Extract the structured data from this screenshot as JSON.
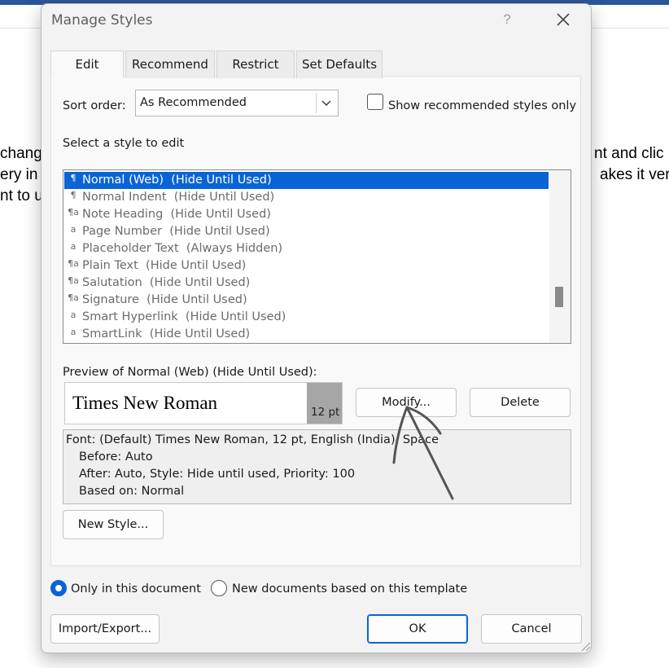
{
  "background": {
    "text_lines_left": [
      "chang",
      "ery in",
      "nt to u"
    ],
    "text_lines_right": [
      "nt and clic",
      "akes it ver"
    ]
  },
  "dialog": {
    "title": "Manage Styles",
    "help_label": "?",
    "close_icon": "close-icon",
    "tabs": [
      {
        "label": "Edit",
        "active": true
      },
      {
        "label": "Recommend",
        "active": false
      },
      {
        "label": "Restrict",
        "active": false
      },
      {
        "label": "Set Defaults",
        "active": false
      }
    ],
    "sort_order": {
      "label": "Sort order:",
      "value": "As Recommended"
    },
    "show_recommended": {
      "label": "Show recommended styles only",
      "checked": false
    },
    "select_label": "Select a style to edit",
    "styles": [
      {
        "icon": "¶",
        "name": "Normal (Web)",
        "note": "(Hide Until Used)",
        "selected": true
      },
      {
        "icon": "¶",
        "name": "Normal Indent",
        "note": "(Hide Until Used)",
        "selected": false
      },
      {
        "icon": "¶a",
        "name": "Note Heading",
        "note": "(Hide Until Used)",
        "selected": false
      },
      {
        "icon": "a",
        "name": "Page Number",
        "note": "(Hide Until Used)",
        "selected": false
      },
      {
        "icon": "a",
        "name": "Placeholder Text",
        "note": "(Always Hidden)",
        "selected": false
      },
      {
        "icon": "¶a",
        "name": "Plain Text",
        "note": "(Hide Until Used)",
        "selected": false
      },
      {
        "icon": "¶a",
        "name": "Salutation",
        "note": "(Hide Until Used)",
        "selected": false
      },
      {
        "icon": "¶a",
        "name": "Signature",
        "note": "(Hide Until Used)",
        "selected": false
      },
      {
        "icon": "a",
        "name": "Smart Hyperlink",
        "note": "(Hide Until Used)",
        "selected": false
      },
      {
        "icon": "a",
        "name": "SmartLink",
        "note": "(Hide Until Used)",
        "selected": false
      }
    ],
    "preview_label": "Preview of Normal (Web)  (Hide Until Used):",
    "preview_font": "Times New Roman",
    "preview_size": "12 pt",
    "modify_label": "Modify...",
    "delete_label": "Delete",
    "description": {
      "line1": "Font: (Default) Times New Roman, 12 pt, English (India), Space",
      "line2": "Before:  Auto",
      "line3": "After:  Auto, Style: Hide until used, Priority: 100",
      "line4": "Based on: Normal"
    },
    "new_style_label": "New Style...",
    "scope_options": [
      {
        "label": "Only in this document",
        "selected": true
      },
      {
        "label": "New documents based on this template",
        "selected": false
      }
    ],
    "import_export_label": "Import/Export...",
    "ok_label": "OK",
    "cancel_label": "Cancel"
  },
  "colors": {
    "accent": "#0a64d6",
    "word_ribbon": "#2b579a",
    "annotation": "#555555"
  }
}
